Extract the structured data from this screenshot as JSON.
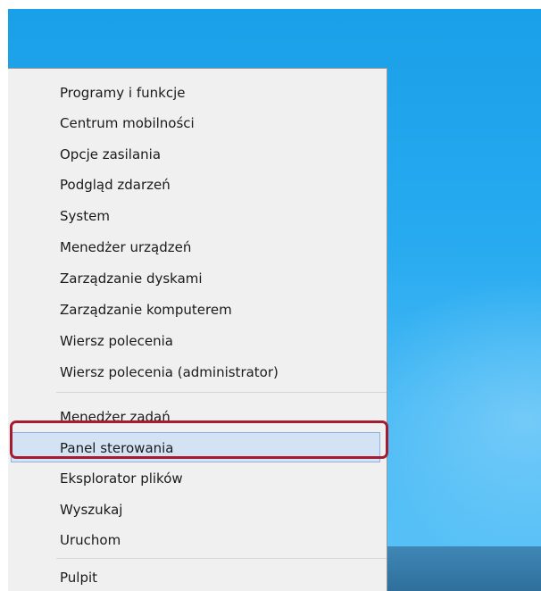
{
  "context_menu": {
    "items": [
      {
        "label": "Programy i funkcje"
      },
      {
        "label": "Centrum mobilności"
      },
      {
        "label": "Opcje zasilania"
      },
      {
        "label": "Podgląd zdarzeń"
      },
      {
        "label": "System"
      },
      {
        "label": "Menedżer urządzeń"
      },
      {
        "label": "Zarządzanie dyskami"
      },
      {
        "label": "Zarządzanie komputerem"
      },
      {
        "label": "Wiersz polecenia"
      },
      {
        "label": "Wiersz polecenia (administrator)"
      },
      {
        "label": "Menedżer zadań"
      },
      {
        "label": "Panel sterowania",
        "state": "hovered"
      },
      {
        "label": "Eksplorator plików"
      },
      {
        "label": "Wyszukaj"
      },
      {
        "label": "Uruchom"
      },
      {
        "label": "Pulpit"
      }
    ]
  },
  "colors": {
    "menu_background": "#f0f0f0",
    "hover_fill": "#d3e3f4",
    "annotation_ring": "#a51c30",
    "desktop_blue": "#27aaf0"
  }
}
